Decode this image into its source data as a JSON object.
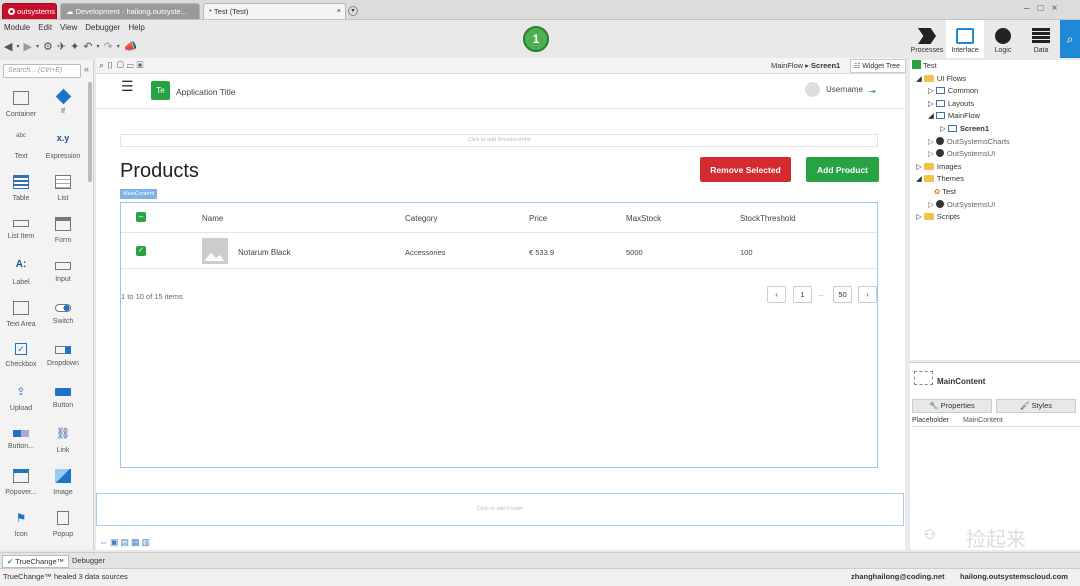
{
  "tabs": [
    {
      "label": "outsystems"
    },
    {
      "label": "Development - hailong.outsyste..."
    },
    {
      "label": "* Test (Test)"
    }
  ],
  "menu": [
    "Module",
    "Edit",
    "View",
    "Debugger",
    "Help"
  ],
  "publish_count": "1",
  "right_tabs": [
    "Processes",
    "Interface",
    "Logic",
    "Data"
  ],
  "search": {
    "placeholder": "Search... (Ctrl+E)"
  },
  "widgets": [
    "Container",
    "If",
    "Text",
    "Expression",
    "Table",
    "List",
    "List Item",
    "Form",
    "Label",
    "Input",
    "Text Area",
    "Switch",
    "Checkbox",
    "Dropdown",
    "Upload",
    "Button",
    "Button...",
    "Link",
    "Popover...",
    "Image",
    "Icon",
    "Popup"
  ],
  "widget_glyphs": {
    "text": "abc",
    "expression": "x.y",
    "label": "A:"
  },
  "breadcrumb": {
    "flow": "MainFlow",
    "screen": "Screen1",
    "widget_tree": "Widget Tree"
  },
  "app": {
    "initials": "Te",
    "title": "Application Title",
    "username": "Username"
  },
  "placeholders": {
    "breadcrumbs": "Click to add Breadcrumbs",
    "footer": "Click to add Footer"
  },
  "page": {
    "title": "Products",
    "remove_label": "Remove Selected",
    "add_label": "Add Product",
    "main_content_tag": "MainContent"
  },
  "table": {
    "headers": [
      "Name",
      "Category",
      "Price",
      "MaxStock",
      "StockThreshold"
    ],
    "row": {
      "name": "Notarum Black",
      "category": "Accessories",
      "price": "€ 533.9",
      "maxstock": "5000",
      "threshold": "100"
    },
    "summary": "1 to 10 of 15 items",
    "pages": [
      "1",
      "...",
      "50"
    ]
  },
  "tree": {
    "root": "Test",
    "ui_flows": "UI Flows",
    "common": "Common",
    "layouts": "Layouts",
    "mainflow": "MainFlow",
    "screen1": "Screen1",
    "charts": "OutSystemsCharts",
    "ui": "OutSystemsUI",
    "images": "Images",
    "themes": "Themes",
    "theme_test": "Test",
    "theme_ui": "OutSystemsUI",
    "scripts": "Scripts"
  },
  "properties": {
    "title": "MainContent",
    "tab_props": "Properties",
    "tab_styles": "Styles",
    "label": "Placeholder",
    "value": "MainContent"
  },
  "bottom_tabs": [
    "TrueChange™",
    "Debugger"
  ],
  "status": {
    "message": "TrueChange™ healed 3 data sources",
    "user": "zhanghailong@coding.net",
    "server": "hailong.outsystemscloud.com"
  },
  "watermark": "捡起来",
  "colors": {
    "green": "#27a344",
    "red": "#d42b30",
    "blue": "#1e88d6",
    "accent": "#4a90d9"
  }
}
